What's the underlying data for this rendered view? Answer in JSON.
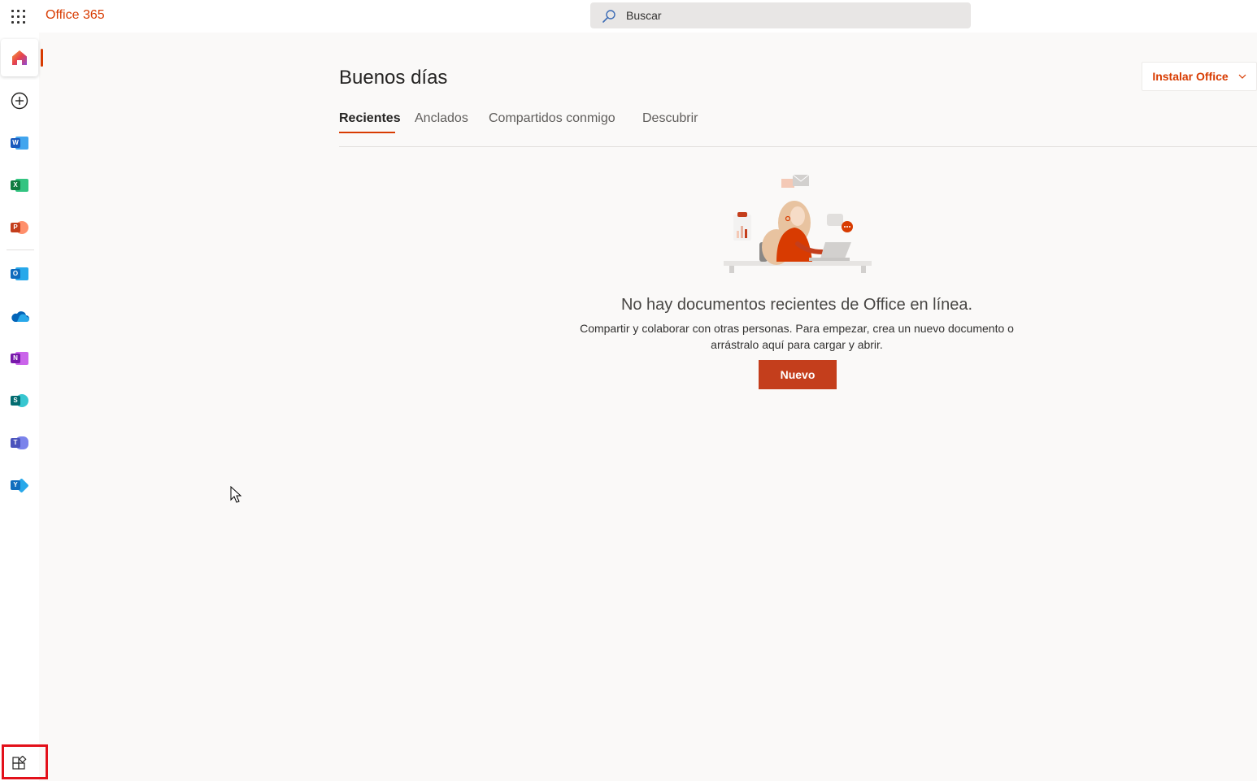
{
  "header": {
    "brand": "Office 365",
    "search_placeholder": "Buscar"
  },
  "rail": {
    "items": [
      {
        "name": "home",
        "icon": "home-icon"
      },
      {
        "name": "create",
        "icon": "plus-circle-icon"
      },
      {
        "name": "word",
        "letter": "W",
        "color": "#185abd"
      },
      {
        "name": "excel",
        "letter": "X",
        "color": "#107c41"
      },
      {
        "name": "powerpoint",
        "letter": "P",
        "color": "#c43e1c"
      },
      {
        "name": "outlook",
        "letter": "O",
        "color": "#0f6cbd"
      },
      {
        "name": "onedrive",
        "icon": "cloud-icon",
        "color": "#0364b8"
      },
      {
        "name": "onenote",
        "letter": "N",
        "color": "#7719aa"
      },
      {
        "name": "sharepoint",
        "letter": "S",
        "color": "#036c70"
      },
      {
        "name": "teams",
        "letter": "T",
        "color": "#4b53bc"
      },
      {
        "name": "yammer",
        "letter": "Y",
        "color": "#106ebe"
      },
      {
        "name": "all-apps",
        "icon": "apps-icon"
      }
    ]
  },
  "main": {
    "greeting": "Buenos días",
    "install_label": "Instalar Office",
    "tabs": [
      {
        "label": "Recientes",
        "active": true
      },
      {
        "label": "Anclados",
        "active": false
      },
      {
        "label": "Compartidos conmigo",
        "active": false
      },
      {
        "label": "Descubrir",
        "active": false
      }
    ],
    "empty_state": {
      "title": "No hay documentos recientes de Office en línea.",
      "description": "Compartir y colaborar con otras personas. Para empezar, crea un nuevo documento o arrástralo aquí para cargar y abrir.",
      "button_label": "Nuevo"
    }
  },
  "colors": {
    "accent": "#d83b01",
    "primary_button": "#c43e1c",
    "highlight_box": "#e3101a"
  }
}
